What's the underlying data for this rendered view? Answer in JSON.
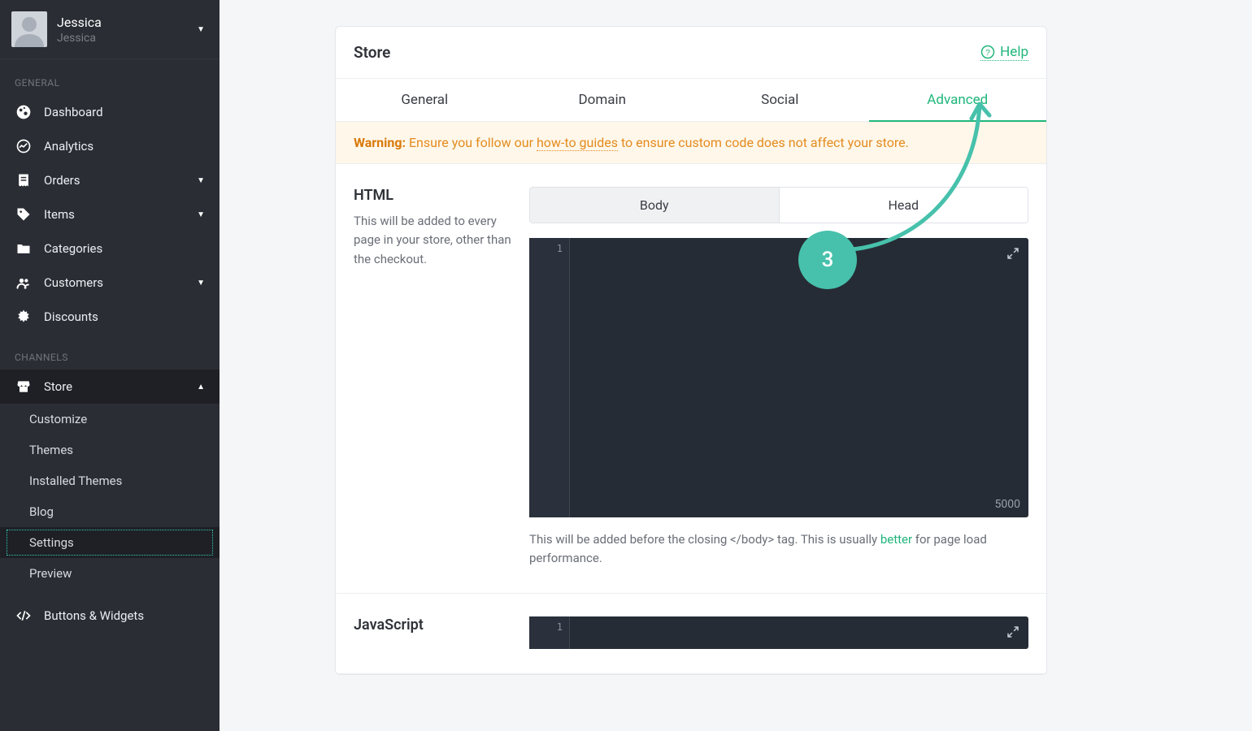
{
  "user": {
    "name": "Jessica",
    "subtitle": "Jessica"
  },
  "sidebar": {
    "section_general": "GENERAL",
    "dashboard": "Dashboard",
    "analytics": "Analytics",
    "orders": "Orders",
    "items": "Items",
    "categories": "Categories",
    "customers": "Customers",
    "discounts": "Discounts",
    "section_channels": "CHANNELS",
    "store": "Store",
    "store_sub": {
      "customize": "Customize",
      "themes": "Themes",
      "installed_themes": "Installed Themes",
      "blog": "Blog",
      "settings": "Settings",
      "preview": "Preview"
    },
    "buttons_widgets": "Buttons & Widgets"
  },
  "header": {
    "title": "Store",
    "help": "Help"
  },
  "tabs": {
    "general": "General",
    "domain": "Domain",
    "social": "Social",
    "advanced": "Advanced"
  },
  "warning": {
    "label": "Warning:",
    "before": " Ensure you follow our ",
    "link": "how-to guides",
    "after": " to ensure custom code does not affect your store."
  },
  "html_section": {
    "title": "HTML",
    "desc": "This will be added to every page in your store, other than the checkout.",
    "seg_body": "Body",
    "seg_head": "Head",
    "line1": "1",
    "counter": "5000",
    "hint_before": "This will be added before the closing </body> tag. This is usually ",
    "hint_link": "better",
    "hint_after": " for page load performance."
  },
  "js_section": {
    "title": "JavaScript",
    "line1": "1"
  },
  "annotation": {
    "step": "3"
  }
}
